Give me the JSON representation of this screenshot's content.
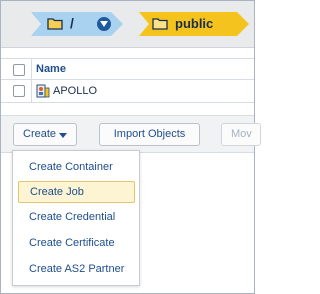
{
  "breadcrumb": {
    "root_label": "/",
    "current_label": "public",
    "colors": {
      "root_fill": "#a8d2f0",
      "current_fill": "#f5c31d"
    }
  },
  "table": {
    "header": {
      "name_col": "Name"
    },
    "rows": [
      {
        "name": "APOLLO",
        "icon": "partner-icon"
      }
    ]
  },
  "toolbar": {
    "create_label": "Create",
    "import_label": "Import Objects",
    "move_label": "Mov"
  },
  "create_menu": {
    "items": [
      {
        "label": "Create Container",
        "active": false
      },
      {
        "label": "Create Job",
        "active": true
      },
      {
        "label": "Create Credential",
        "active": false
      },
      {
        "label": "Create Certificate",
        "active": false
      },
      {
        "label": "Create AS2 Partner",
        "active": false
      }
    ]
  }
}
